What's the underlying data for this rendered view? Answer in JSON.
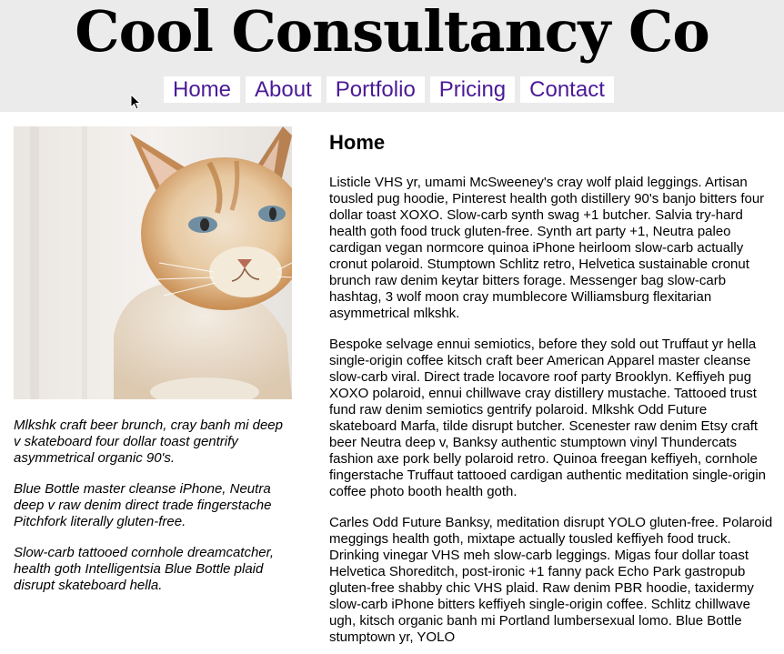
{
  "site": {
    "title": "Cool Consultancy Co"
  },
  "nav": {
    "items": [
      {
        "label": "Home"
      },
      {
        "label": "About"
      },
      {
        "label": "Portfolio"
      },
      {
        "label": "Pricing"
      },
      {
        "label": "Contact"
      }
    ]
  },
  "sidebar": {
    "image_subject": "cat-photo",
    "paragraphs": [
      "Mlkshk craft beer brunch, cray banh mi deep v skateboard four dollar toast gentrify asymmetrical organic 90's.",
      "Blue Bottle master cleanse iPhone, Neutra deep v raw denim direct trade fingerstache Pitchfork literally gluten-free.",
      "Slow-carb tattooed cornhole dreamcatcher, health goth Intelligentsia Blue Bottle plaid disrupt skateboard hella."
    ]
  },
  "main": {
    "heading": "Home",
    "paragraphs": [
      "Listicle VHS yr, umami McSweeney's cray wolf plaid leggings. Artisan tousled pug hoodie, Pinterest health goth distillery 90's banjo bitters four dollar toast XOXO. Slow-carb synth swag +1 butcher. Salvia try-hard health goth food truck gluten-free. Synth art party +1, Neutra paleo cardigan vegan normcore quinoa iPhone heirloom slow-carb actually cronut polaroid. Stumptown Schlitz retro, Helvetica sustainable cronut brunch raw denim keytar bitters forage. Messenger bag slow-carb hashtag, 3 wolf moon cray mumblecore Williamsburg flexitarian asymmetrical mlkshk.",
      "Bespoke selvage ennui semiotics, before they sold out Truffaut yr hella single-origin coffee kitsch craft beer American Apparel master cleanse slow-carb viral. Direct trade locavore roof party Brooklyn. Keffiyeh pug XOXO polaroid, ennui chillwave cray distillery mustache. Tattooed trust fund raw denim semiotics gentrify polaroid. Mlkshk Odd Future skateboard Marfa, tilde disrupt butcher. Scenester raw denim Etsy craft beer Neutra deep v, Banksy authentic stumptown vinyl Thundercats fashion axe pork belly polaroid retro. Quinoa freegan keffiyeh, cornhole fingerstache Truffaut tattooed cardigan authentic meditation single-origin coffee photo booth health goth.",
      "Carles Odd Future Banksy, meditation disrupt YOLO gluten-free. Polaroid meggings health goth, mixtape actually tousled keffiyeh food truck. Drinking vinegar VHS meh slow-carb leggings. Migas four dollar toast Helvetica Shoreditch, post-ironic +1 fanny pack Echo Park gastropub gluten-free shabby chic VHS plaid. Raw denim PBR hoodie, taxidermy slow-carb iPhone bitters keffiyeh single-origin coffee. Schlitz chillwave ugh, kitsch organic banh mi Portland lumbersexual lomo. Blue Bottle stumptown yr, YOLO"
    ]
  },
  "colors": {
    "header_bg": "#ebebeb",
    "nav_link": "#4b1a96",
    "nav_bg": "#ffffff"
  }
}
